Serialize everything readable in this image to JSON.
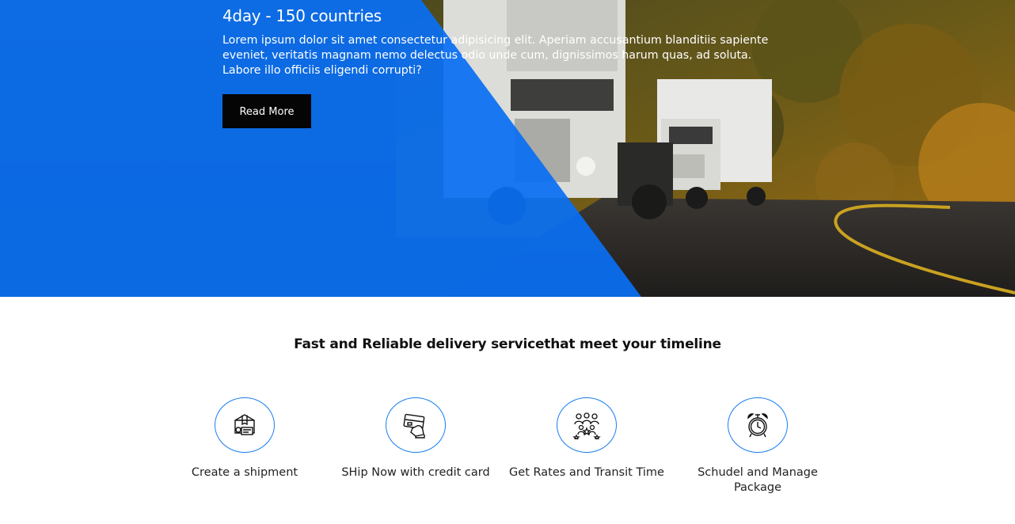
{
  "hero": {
    "title": "4day - 150 countries",
    "description": "Lorem ipsum dolor sit amet consectetur adipisicing elit. Aperiam accusantium blanditiis sapiente eveniet, veritatis magnam nemo delectus odio unde cum, dignissimos harum quas, ad soluta. Labore illo officiis eligendi corrupti?",
    "button_label": "Read More",
    "overlay_color": "#0a6ff2"
  },
  "section": {
    "title": "Fast and Reliable delivery servicethat meet your timeline",
    "accent_color": "#1a7ef2"
  },
  "features": [
    {
      "label": "Create a shipment",
      "icon": "package-box-icon"
    },
    {
      "label": "SHip Now with credit card",
      "icon": "credit-card-hand-icon"
    },
    {
      "label": "Get Rates and Transit Time",
      "icon": "people-rating-stars-icon"
    },
    {
      "label": "Schudel and Manage Package",
      "icon": "alarm-clock-icon"
    }
  ]
}
